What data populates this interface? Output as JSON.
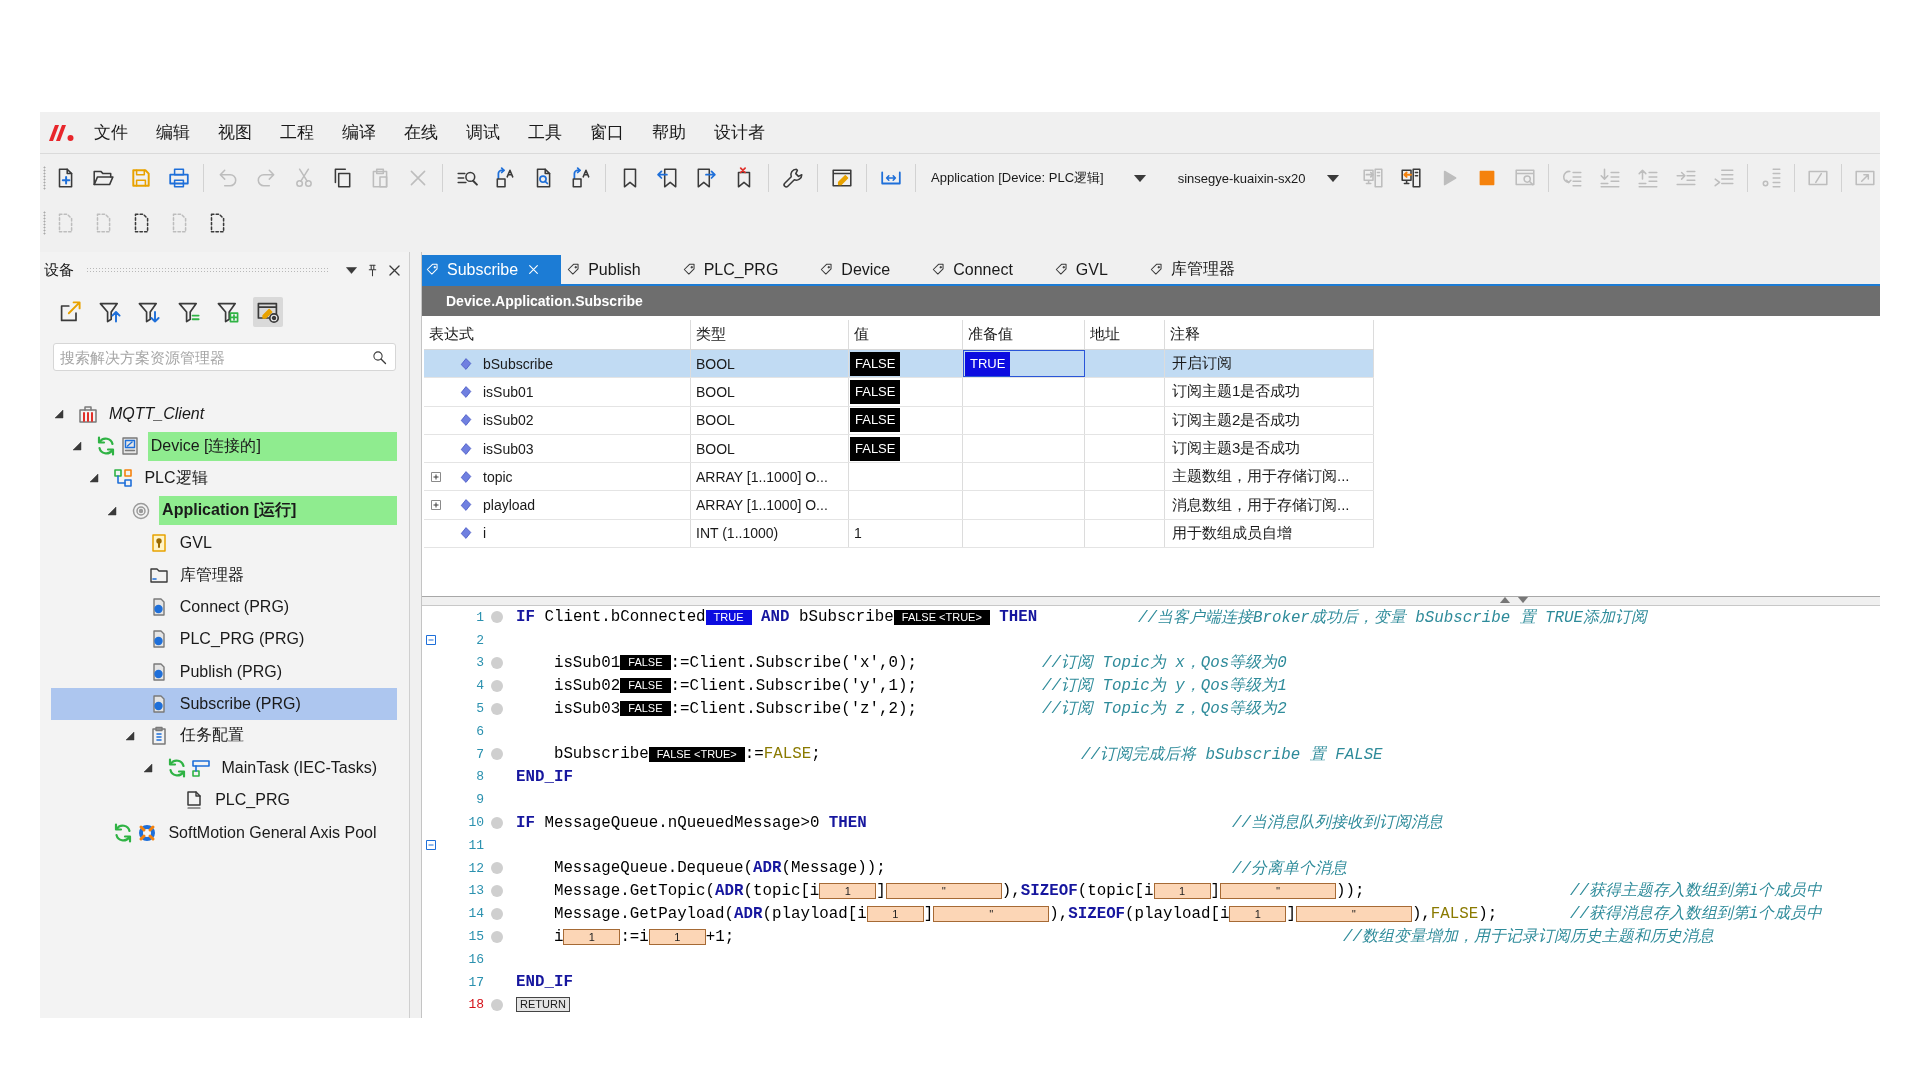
{
  "menu_bar": {
    "items": [
      "文件",
      "编辑",
      "视图",
      "工程",
      "编译",
      "在线",
      "调试",
      "工具",
      "窗口",
      "帮助",
      "设计者"
    ]
  },
  "toolbar": {
    "row_1": {
      "left_groups": [
        [
          {
            "kind": "new-file",
            "disabled": false
          },
          {
            "kind": "open",
            "disabled": false
          },
          {
            "kind": "save",
            "disabled": false
          },
          {
            "kind": "print",
            "disabled": false
          }
        ],
        [
          {
            "kind": "undo",
            "disabled": true
          },
          {
            "kind": "redo",
            "disabled": true
          },
          {
            "kind": "cut",
            "disabled": true
          },
          {
            "kind": "copy",
            "disabled": false
          },
          {
            "kind": "paste",
            "disabled": true
          },
          {
            "kind": "delete",
            "disabled": true
          }
        ],
        [
          {
            "kind": "find",
            "disabled": false
          },
          {
            "kind": "replace",
            "disabled": false
          },
          {
            "kind": "find-page",
            "disabled": false
          },
          {
            "kind": "replace-letter",
            "disabled": false
          }
        ],
        [
          {
            "kind": "bookmark",
            "disabled": false
          },
          {
            "kind": "bookmark-prev",
            "disabled": false
          },
          {
            "kind": "bookmark-next",
            "disabled": false
          },
          {
            "kind": "bookmark-clear",
            "disabled": false
          }
        ],
        [
          {
            "kind": "wrench",
            "disabled": false
          }
        ],
        [
          {
            "kind": "window-edit",
            "disabled": false
          }
        ],
        [
          {
            "kind": "fit-width",
            "disabled": false
          }
        ]
      ],
      "selectors": [
        "Application [Device: PLC逻辑]",
        "sinsegye-kuaixin-sx20"
      ],
      "right_groups": [
        [
          {
            "kind": "login",
            "disabled": true
          },
          {
            "kind": "logout",
            "disabled": false
          },
          {
            "kind": "run",
            "disabled": true
          },
          {
            "kind": "stop",
            "disabled": false
          },
          {
            "kind": "reset",
            "disabled": true
          }
        ],
        [
          {
            "kind": "step-over",
            "disabled": true
          },
          {
            "kind": "step-into",
            "disabled": true
          },
          {
            "kind": "step-out",
            "disabled": true
          },
          {
            "kind": "run-to-cursor",
            "disabled": true
          },
          {
            "kind": "set-next",
            "disabled": true
          }
        ],
        [
          {
            "kind": "breakpoint",
            "disabled": true
          }
        ],
        [
          {
            "kind": "panel",
            "disabled": true
          }
        ],
        [
          {
            "kind": "panel-arrow",
            "disabled": true
          }
        ]
      ]
    },
    "row_2": [
      {
        "kind": "dashed-page",
        "disabled": true
      },
      {
        "kind": "dashed-page",
        "disabled": true
      },
      {
        "kind": "dashed-page",
        "disabled": false
      },
      {
        "kind": "dashed-page",
        "disabled": true
      },
      {
        "kind": "dashed-page",
        "disabled": false
      }
    ]
  },
  "device_panel": {
    "title": "设备",
    "tools": [
      {
        "kind": "open-window",
        "on": false
      },
      {
        "kind": "filter-up",
        "on": false
      },
      {
        "kind": "filter-down",
        "on": false
      },
      {
        "kind": "filter-lines",
        "on": false
      },
      {
        "kind": "filter-box",
        "on": false
      },
      {
        "kind": "window-gear",
        "on": true
      }
    ],
    "search": {
      "placeholder": "搜索解决方案资源管理器"
    },
    "tree": [
      {
        "label": "MQTT_Client",
        "kind": "project",
        "expanded": true,
        "selected": false,
        "online": false,
        "children": [
          {
            "label": "Device [连接的]",
            "kind": "device",
            "expanded": true,
            "selected": false,
            "online": true,
            "children": [
              {
                "label": "PLC逻辑",
                "kind": "plc-logic",
                "expanded": true,
                "selected": false,
                "online": false,
                "children": [
                  {
                    "label": "Application [运行]",
                    "kind": "application",
                    "expanded": true,
                    "selected": false,
                    "online": true,
                    "children": [
                      {
                        "label": "GVL",
                        "kind": "gvl",
                        "selected": false,
                        "online": false
                      },
                      {
                        "label": "库管理器",
                        "kind": "library",
                        "selected": false,
                        "online": false
                      },
                      {
                        "label": "Connect (PRG)",
                        "kind": "program",
                        "selected": false,
                        "online": false
                      },
                      {
                        "label": "PLC_PRG (PRG)",
                        "kind": "program",
                        "selected": false,
                        "online": false
                      },
                      {
                        "label": "Publish (PRG)",
                        "kind": "program",
                        "selected": false,
                        "online": false
                      },
                      {
                        "label": "Subscribe (PRG)",
                        "kind": "program",
                        "selected": true,
                        "online": false
                      },
                      {
                        "label": "任务配置",
                        "kind": "task-config",
                        "expanded": true,
                        "selected": false,
                        "online": false,
                        "children": [
                          {
                            "label": "MainTask (IEC-Tasks)",
                            "kind": "task",
                            "expanded": true,
                            "selected": false,
                            "online": false,
                            "children": [
                              {
                                "label": "PLC_PRG",
                                "kind": "task-call",
                                "selected": false,
                                "online": false
                              }
                            ]
                          }
                        ]
                      }
                    ]
                  }
                ]
              },
              {
                "label": "SoftMotion General Axis Pool",
                "kind": "axis-pool",
                "selected": false,
                "online": false
              }
            ]
          }
        ]
      }
    ]
  },
  "editor": {
    "tabs": [
      {
        "label": "Subscribe",
        "selected": true
      },
      {
        "label": "Publish",
        "selected": false
      },
      {
        "label": "PLC_PRG",
        "selected": false
      },
      {
        "label": "Device",
        "selected": false
      },
      {
        "label": "Connect",
        "selected": false
      },
      {
        "label": "GVL",
        "selected": false
      },
      {
        "label": "库管理器",
        "selected": false
      }
    ],
    "path": "Device.Application.Subscribe",
    "table": {
      "columns": [
        "表达式",
        "类型",
        "值",
        "准备值",
        "地址",
        "注释"
      ],
      "rows": [
        {
          "expression": "bSubscribe",
          "type": "BOOL",
          "value": {
            "text": "FALSE",
            "kind": "bool",
            "on": false
          },
          "prepared_value": {
            "text": "TRUE",
            "kind": "bool",
            "on": true
          },
          "comment": "开启订阅",
          "selected": true
        },
        {
          "expression": "isSub01",
          "type": "BOOL",
          "value": {
            "text": "FALSE",
            "kind": "bool",
            "on": false
          },
          "comment": "订阅主题1是否成功",
          "selected": false
        },
        {
          "expression": "isSub02",
          "type": "BOOL",
          "value": {
            "text": "FALSE",
            "kind": "bool",
            "on": false
          },
          "comment": "订阅主题2是否成功",
          "selected": false
        },
        {
          "expression": "isSub03",
          "type": "BOOL",
          "value": {
            "text": "FALSE",
            "kind": "bool",
            "on": false
          },
          "comment": "订阅主题3是否成功",
          "selected": false
        },
        {
          "expression": "topic",
          "type": "ARRAY [1..1000] O...",
          "comment": "主题数组，用于存储订阅...",
          "selected": false,
          "expanded": false
        },
        {
          "expression": "playload",
          "type": "ARRAY [1..1000] O...",
          "comment": "消息数组，用于存储订阅...",
          "selected": false,
          "expanded": false
        },
        {
          "expression": "i",
          "type": "INT (1..1000)",
          "value": {
            "text": "1",
            "kind": "plain"
          },
          "comment": "用于数组成员自增",
          "selected": false
        }
      ]
    },
    "code": {
      "lines": [
        {
          "number": "1",
          "fold": false,
          "step_marker": true,
          "current": false,
          "segments": [
            {
              "kind": "keyword",
              "text": "IF"
            },
            {
              "kind": "plain",
              "text": " Client.bConnected"
            },
            {
              "kind": "monitor",
              "text": "TRUE",
              "on": true
            },
            {
              "kind": "keyword",
              "text": " AND"
            },
            {
              "kind": "plain",
              "text": " bSubscribe"
            },
            {
              "kind": "monitor",
              "text": "FALSE <TRUE>",
              "on": false
            },
            {
              "kind": "keyword",
              "text": " THEN"
            }
          ],
          "comment": "//当客户端连接Broker成功后，变量 bSubscribe 置 TRUE添加订阅",
          "children": [
            {
              "number": "2",
              "fold": true,
              "step_marker": false,
              "current": false
            },
            {
              "number": "3",
              "fold": false,
              "step_marker": true,
              "current": false,
              "segments": [
                {
                  "kind": "plain",
                  "text": "isSub01"
                },
                {
                  "kind": "monitor",
                  "text": "FALSE",
                  "on": false
                },
                {
                  "kind": "plain",
                  "text": ":=Client.Subscribe('x',0);"
                }
              ],
              "comment": "//订阅 Topic为 x，Qos等级为0"
            },
            {
              "number": "4",
              "fold": false,
              "step_marker": true,
              "current": false,
              "segments": [
                {
                  "kind": "plain",
                  "text": "isSub02"
                },
                {
                  "kind": "monitor",
                  "text": "FALSE",
                  "on": false
                },
                {
                  "kind": "plain",
                  "text": ":=Client.Subscribe('y',1);"
                }
              ],
              "comment": "//订阅 Topic为 y，Qos等级为1"
            },
            {
              "number": "5",
              "fold": false,
              "step_marker": true,
              "current": false,
              "segments": [
                {
                  "kind": "plain",
                  "text": "isSub03"
                },
                {
                  "kind": "monitor",
                  "text": "FALSE",
                  "on": false
                },
                {
                  "kind": "plain",
                  "text": ":=Client.Subscribe('z',2);"
                }
              ],
              "comment": "//订阅 Topic为 z，Qos等级为2"
            },
            {
              "number": "6",
              "fold": false,
              "step_marker": false,
              "current": false
            },
            {
              "number": "7",
              "fold": false,
              "step_marker": true,
              "current": false,
              "segments": [
                {
                  "kind": "plain",
                  "text": "bSubscribe"
                },
                {
                  "kind": "monitor",
                  "text": "FALSE <TRUE>",
                  "on": false
                },
                {
                  "kind": "plain",
                  "text": ":="
                },
                {
                  "kind": "literal",
                  "text": "FALSE"
                },
                {
                  "kind": "plain",
                  "text": ";"
                }
              ],
              "comment": "//订阅完成后将 bSubscribe 置 FALSE"
            }
          ]
        },
        {
          "number": "8",
          "fold": false,
          "step_marker": false,
          "current": false,
          "segments": [
            {
              "kind": "keyword",
              "text": "END_IF"
            }
          ]
        },
        {
          "number": "9",
          "fold": false,
          "step_marker": false,
          "current": false
        },
        {
          "number": "10",
          "fold": false,
          "step_marker": true,
          "current": false,
          "segments": [
            {
              "kind": "keyword",
              "text": "IF"
            },
            {
              "kind": "plain",
              "text": " MessageQueue.nQueuedMessage>0"
            },
            {
              "kind": "keyword",
              "text": " THEN"
            }
          ],
          "comment": "//当消息队列接收到订阅消息",
          "children": [
            {
              "number": "11",
              "fold": true,
              "step_marker": false,
              "current": false
            },
            {
              "number": "12",
              "fold": false,
              "step_marker": true,
              "current": false,
              "segments": [
                {
                  "kind": "plain",
                  "text": "MessageQueue.Dequeue("
                },
                {
                  "kind": "keyword",
                  "text": "ADR"
                },
                {
                  "kind": "plain",
                  "text": "(Message));"
                }
              ],
              "comment": "//分离单个消息"
            },
            {
              "number": "13",
              "fold": false,
              "step_marker": true,
              "current": false,
              "segments": [
                {
                  "kind": "plain",
                  "text": "Message.GetTopic("
                },
                {
                  "kind": "keyword",
                  "text": "ADR"
                },
                {
                  "kind": "plain",
                  "text": "(topic[i"
                },
                {
                  "kind": "watch_int",
                  "text": "1"
                },
                {
                  "kind": "plain",
                  "text": "]"
                },
                {
                  "kind": "watch_string",
                  "text": "''"
                },
                {
                  "kind": "plain",
                  "text": "),"
                },
                {
                  "kind": "keyword",
                  "text": "SIZEOF"
                },
                {
                  "kind": "plain",
                  "text": "(topic[i"
                },
                {
                  "kind": "watch_int",
                  "text": "1"
                },
                {
                  "kind": "plain",
                  "text": "]"
                },
                {
                  "kind": "watch_string",
                  "text": "''"
                },
                {
                  "kind": "plain",
                  "text": "));"
                }
              ],
              "comment": "//获得主题存入数组到第i个成员中"
            },
            {
              "number": "14",
              "fold": false,
              "step_marker": true,
              "current": false,
              "segments": [
                {
                  "kind": "plain",
                  "text": "Message.GetPayload("
                },
                {
                  "kind": "keyword",
                  "text": "ADR"
                },
                {
                  "kind": "plain",
                  "text": "(playload[i"
                },
                {
                  "kind": "watch_int",
                  "text": "1"
                },
                {
                  "kind": "plain",
                  "text": "]"
                },
                {
                  "kind": "watch_string",
                  "text": "''"
                },
                {
                  "kind": "plain",
                  "text": "),"
                },
                {
                  "kind": "keyword",
                  "text": "SIZEOF"
                },
                {
                  "kind": "plain",
                  "text": "(playload[i"
                },
                {
                  "kind": "watch_int",
                  "text": "1"
                },
                {
                  "kind": "plain",
                  "text": "]"
                },
                {
                  "kind": "watch_string",
                  "text": "''"
                },
                {
                  "kind": "plain",
                  "text": "),"
                },
                {
                  "kind": "literal",
                  "text": "FALSE"
                },
                {
                  "kind": "plain",
                  "text": ");"
                }
              ],
              "comment": "//获得消息存入数组到第i个成员中"
            },
            {
              "number": "15",
              "fold": false,
              "step_marker": true,
              "current": false,
              "segments": [
                {
                  "kind": "plain",
                  "text": "i"
                },
                {
                  "kind": "watch_int",
                  "text": "1"
                },
                {
                  "kind": "plain",
                  "text": ":=i"
                },
                {
                  "kind": "watch_int",
                  "text": "1"
                },
                {
                  "kind": "plain",
                  "text": "+1;"
                }
              ],
              "comment": "//数组变量增加，用于记录订阅历史主题和历史消息"
            }
          ]
        },
        {
          "number": "16",
          "fold": false,
          "step_marker": false,
          "current": false
        },
        {
          "number": "17",
          "fold": false,
          "step_marker": false,
          "current": false,
          "segments": [
            {
              "kind": "keyword",
              "text": "END_IF"
            }
          ]
        },
        {
          "number": "18",
          "fold": false,
          "step_marker": true,
          "current": true,
          "segments": [
            {
              "kind": "return",
              "text": "RETURN"
            }
          ]
        }
      ]
    }
  }
}
